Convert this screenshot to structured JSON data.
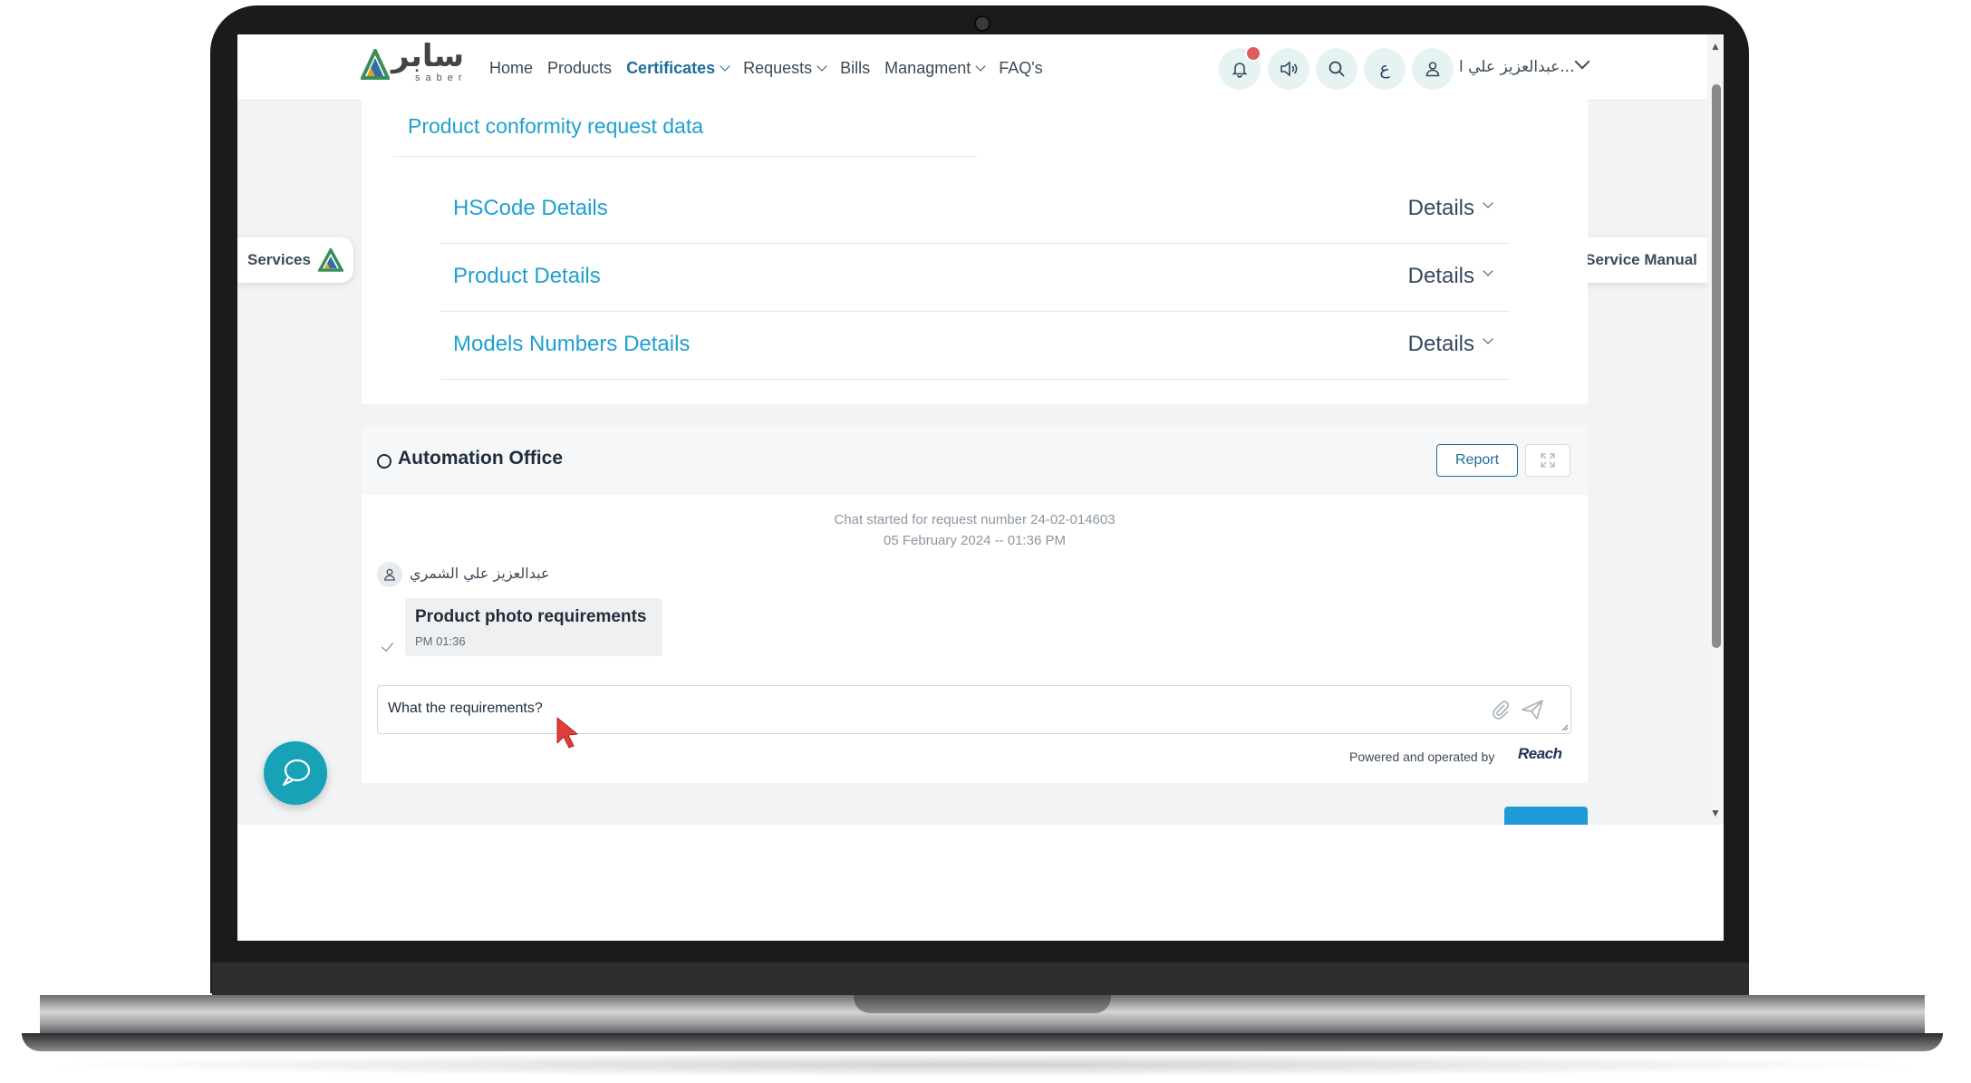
{
  "header": {
    "logo_text": "سابر",
    "logo_sub": "saber",
    "nav": [
      {
        "label": "Home",
        "dropdown": false
      },
      {
        "label": "Products",
        "dropdown": false
      },
      {
        "label": "Certificates",
        "dropdown": true,
        "active": true
      },
      {
        "label": "Requests",
        "dropdown": true
      },
      {
        "label": "Bills",
        "dropdown": false
      },
      {
        "label": "Managment",
        "dropdown": true
      },
      {
        "label": "FAQ's",
        "dropdown": false
      }
    ],
    "icons": [
      "bell-icon",
      "speaker-icon",
      "search-icon",
      "language-icon",
      "user-icon"
    ],
    "language_label": "ع",
    "user_name": "عبدالعزيز علي ا...",
    "accent_color": "#1ea0cf",
    "notification_color": "#e05b5b"
  },
  "side_tabs": {
    "services": "Services",
    "service_manual": "Service Manual"
  },
  "conformity": {
    "title": "Product conformity request data",
    "rows": [
      {
        "label": "HSCode Details",
        "action": "Details"
      },
      {
        "label": "Product Details",
        "action": "Details"
      },
      {
        "label": "Models Numbers Details",
        "action": "Details"
      }
    ]
  },
  "chat": {
    "title": "Automation Office",
    "report_label": "Report",
    "started_text": "Chat started for request number 24-02-014603",
    "started_date": "05 February 2024 -- 01:36 PM",
    "sender_name": "عبدالعزيز علي الشمري",
    "message": {
      "text": "Product photo requirements",
      "time": "PM 01:36"
    },
    "input_value": "What the requirements?",
    "powered_by": "Powered and operated by",
    "powered_brand": "Reach"
  }
}
